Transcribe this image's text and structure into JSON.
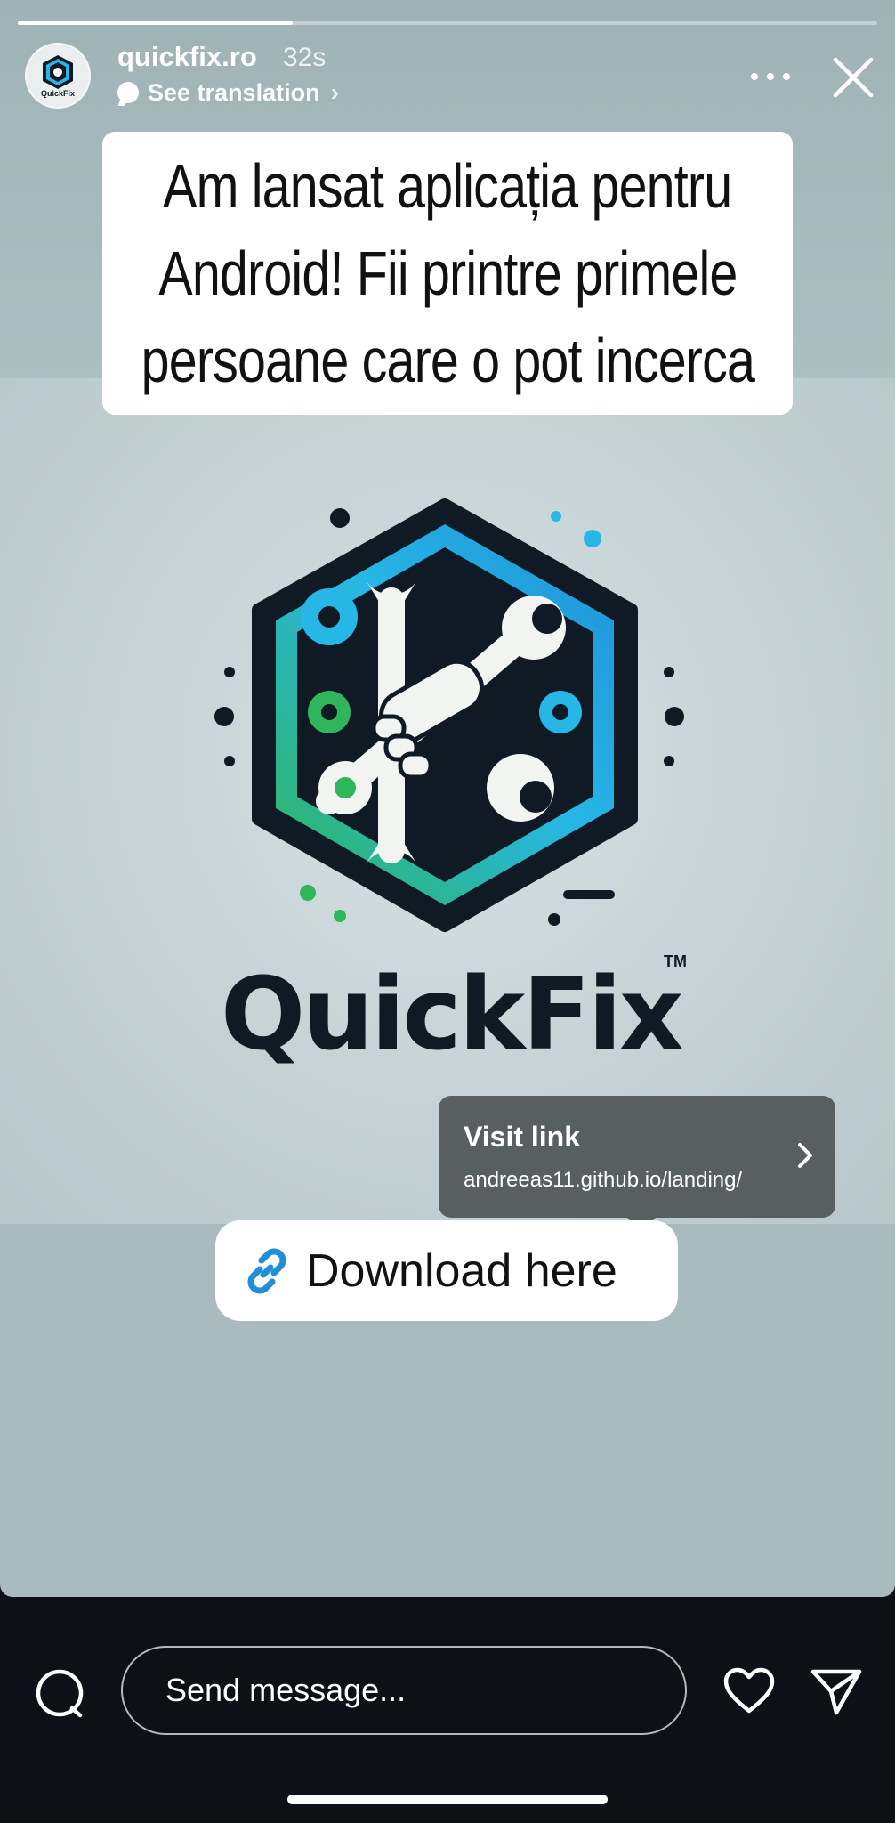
{
  "story": {
    "progress": 0.32,
    "username": "quickfix.ro",
    "time_ago": "32s",
    "translation_label": "See translation",
    "avatar_caption": "QuickFix",
    "caption_lines": [
      "Am lansat aplicația pentru",
      "Android! Fii printre primele",
      "persoane care o pot incerca"
    ],
    "logo_wordmark": "QuickFix",
    "logo_tm": "TM",
    "visit_link": {
      "title": "Visit link",
      "url": "andreeas11.github.io/landing/"
    },
    "link_sticker_label": "Download here"
  },
  "composer": {
    "placeholder": "Send message..."
  },
  "colors": {
    "story_background": "#a9bbbe",
    "tooltip_background": "#58605f",
    "link_blue": "#1e8fd8",
    "logo_green": "#2fb55a",
    "logo_cyan": "#27b7e6",
    "logo_dark": "#0f1a24",
    "bottom_bar": "#0d1117"
  },
  "icons": [
    "more-icon",
    "close-icon",
    "link-icon",
    "chevron-right-icon",
    "camera-icon",
    "heart-icon",
    "send-icon",
    "translate-bubble-icon"
  ]
}
